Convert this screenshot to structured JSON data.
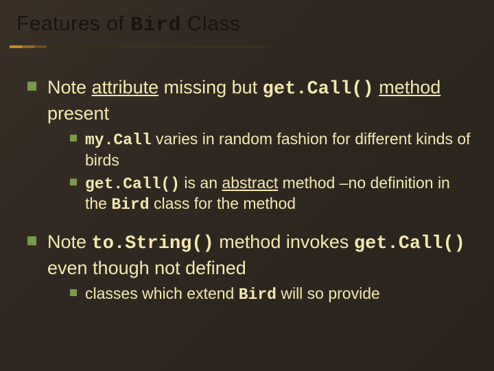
{
  "title": {
    "prefix": "Features of ",
    "code": "Bird",
    "suffix": " Class"
  },
  "points": [
    {
      "parts": [
        {
          "t": "Note "
        },
        {
          "t": "attribute",
          "under": true
        },
        {
          "t": " missing but "
        },
        {
          "t": "get.Call()",
          "mono": true
        },
        {
          "t": " "
        },
        {
          "t": "method",
          "under": true
        },
        {
          "t": " present"
        }
      ],
      "sub": [
        {
          "parts": [
            {
              "t": "my.Call",
              "mono": true
            },
            {
              "t": " varies in random fashion for different kinds of birds"
            }
          ]
        },
        {
          "parts": [
            {
              "t": "get.Call()",
              "mono": true
            },
            {
              "t": " is an "
            },
            {
              "t": "abstract",
              "under": true
            },
            {
              "t": " method –no definition in the "
            },
            {
              "t": "Bird",
              "mono": true
            },
            {
              "t": " class for the method"
            }
          ]
        }
      ]
    },
    {
      "parts": [
        {
          "t": "Note "
        },
        {
          "t": "to.String()",
          "mono": true
        },
        {
          "t": " method invokes "
        },
        {
          "t": "get.Call()",
          "mono": true
        },
        {
          "t": " even though not defined"
        }
      ],
      "sub": [
        {
          "parts": [
            {
              "t": "classes which extend "
            },
            {
              "t": "Bird",
              "mono": true
            },
            {
              "t": " will so provide"
            }
          ]
        }
      ]
    }
  ]
}
